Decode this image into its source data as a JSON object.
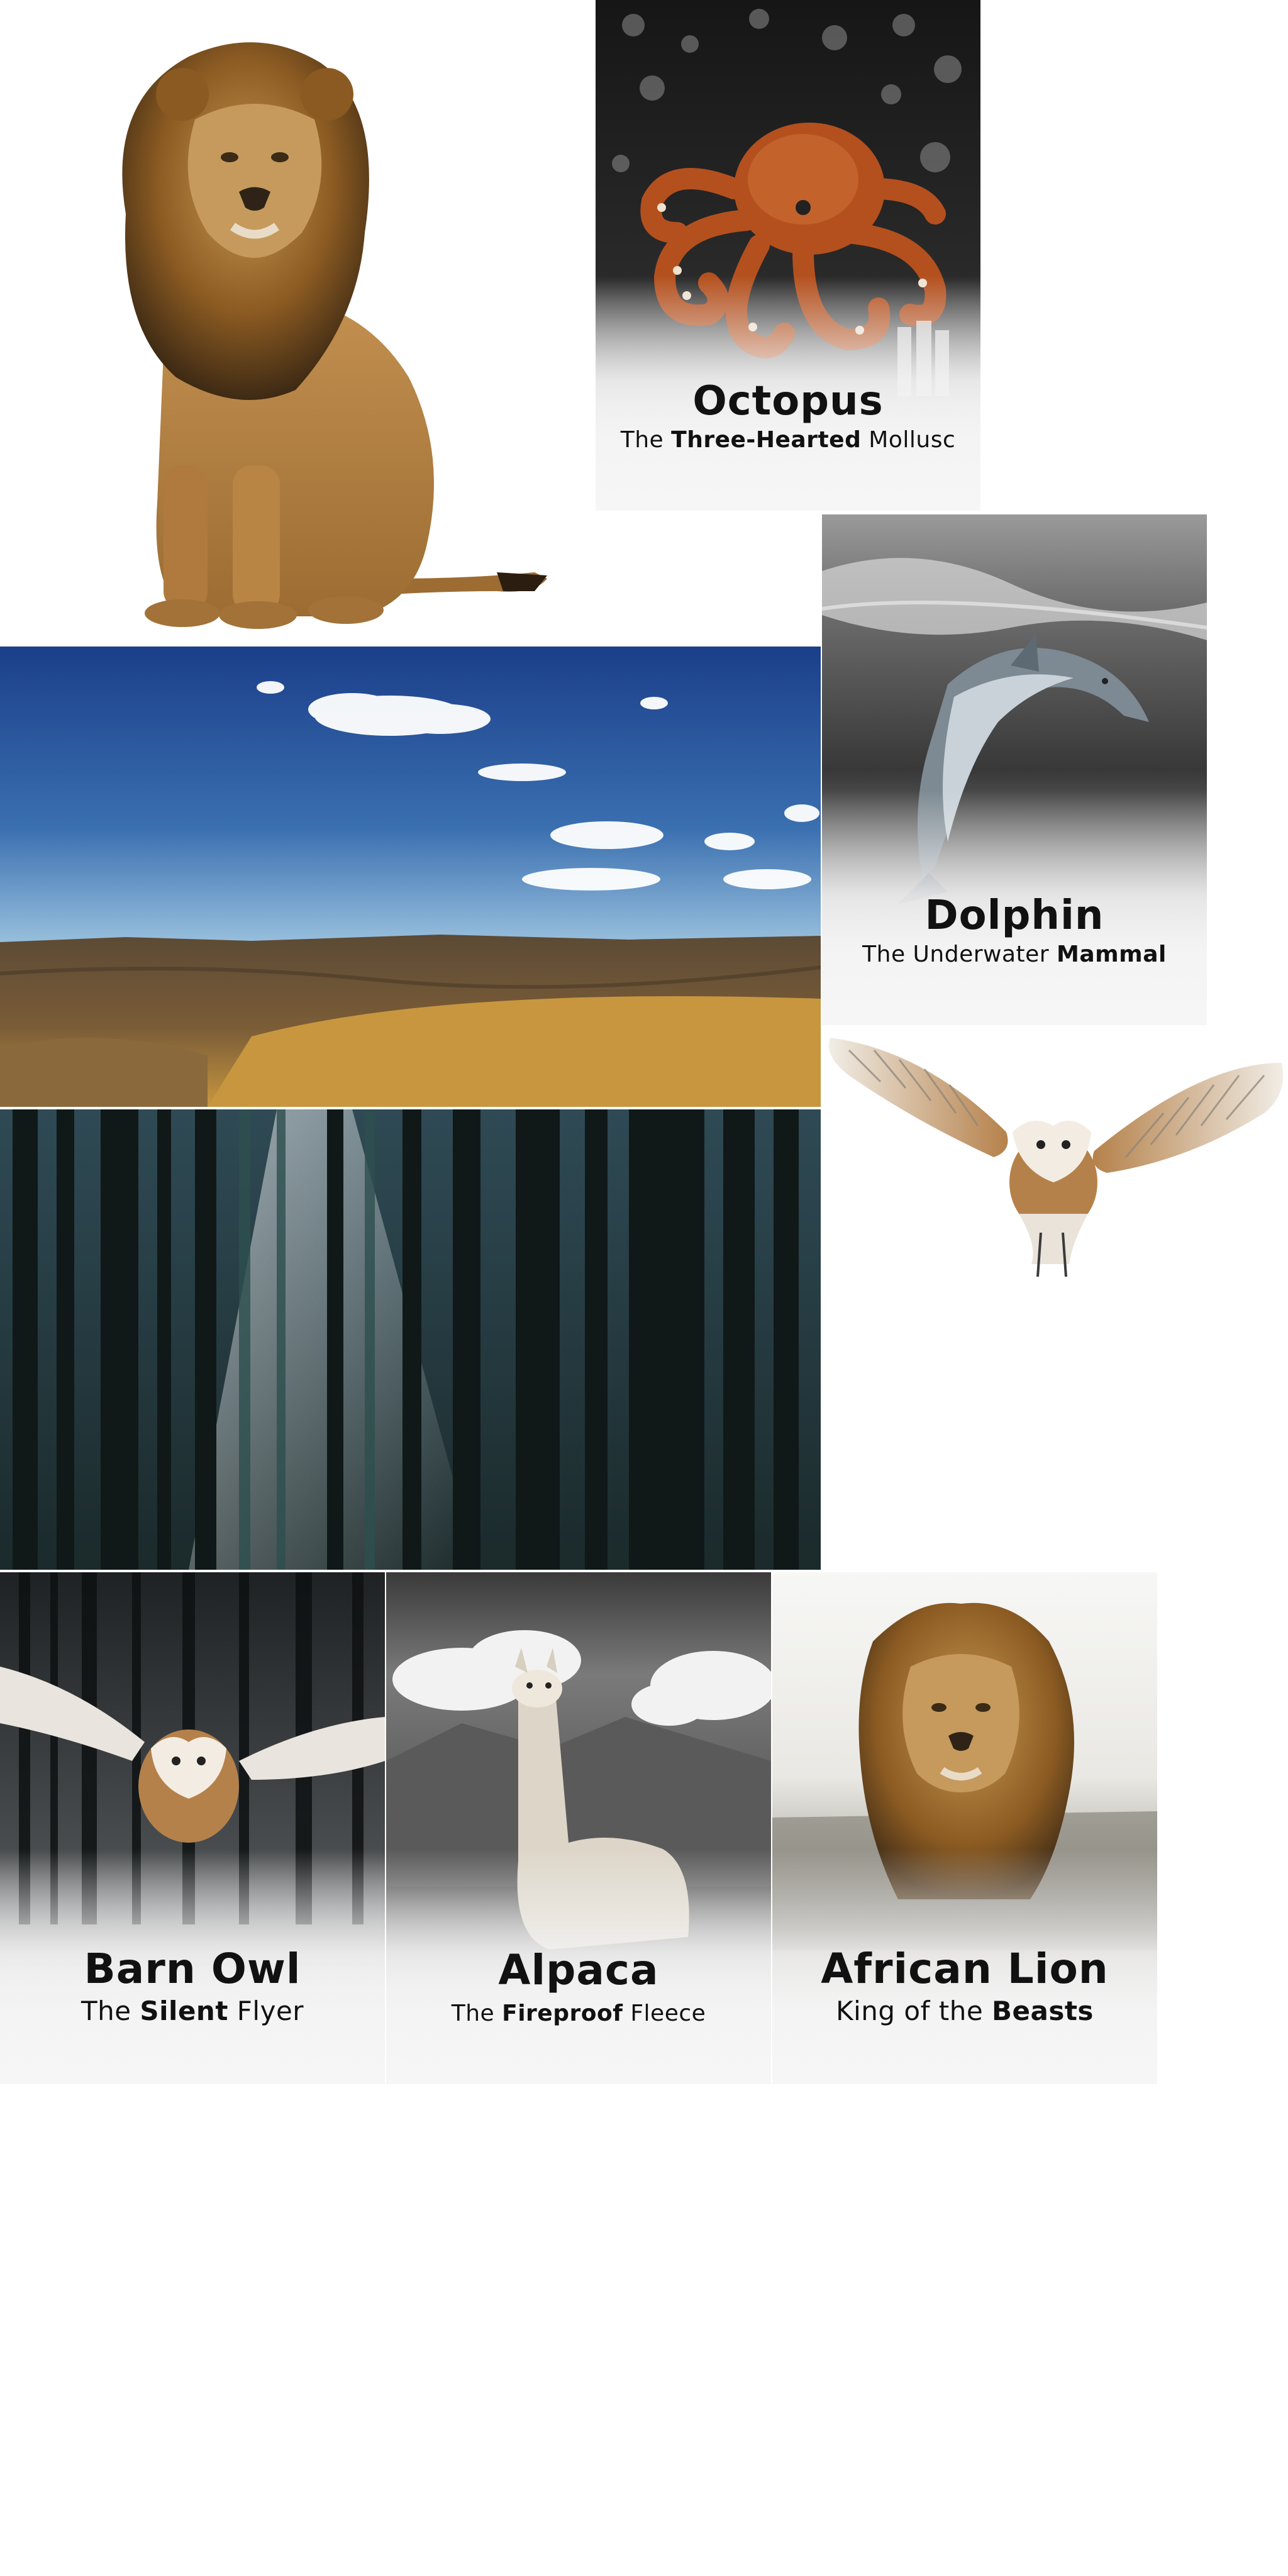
{
  "cards": {
    "octopus": {
      "title": "Octopus",
      "subtitle_pre": "The ",
      "subtitle_bold": "Three-Hearted",
      "subtitle_post": " Mollusc"
    },
    "dolphin": {
      "title": "Dolphin",
      "subtitle_pre": "The Underwater ",
      "subtitle_bold": "Mammal",
      "subtitle_post": ""
    },
    "barn_owl": {
      "title": "Barn Owl",
      "subtitle_pre": "The ",
      "subtitle_bold": "Silent",
      "subtitle_post": " Flyer"
    },
    "alpaca": {
      "title": "Alpaca",
      "subtitle_pre": "The ",
      "subtitle_bold": "Fireproof",
      "subtitle_post": " Fleece"
    },
    "african_lion": {
      "title": "African Lion",
      "subtitle_pre": "King of the ",
      "subtitle_bold": "Beasts",
      "subtitle_post": ""
    }
  },
  "assets": {
    "lion_cutout": "lion-image",
    "landscape": "badlands-landscape-image",
    "forest": "forest-image",
    "owl_cutout": "barn-owl-image"
  },
  "colors": {
    "sky_top": "#1b3f8a",
    "sky_bottom": "#7fb2d8",
    "lion_mane": "#8a5a22",
    "owl_feather": "#b5814a",
    "octopus": "#b4501e",
    "text": "#111111"
  }
}
